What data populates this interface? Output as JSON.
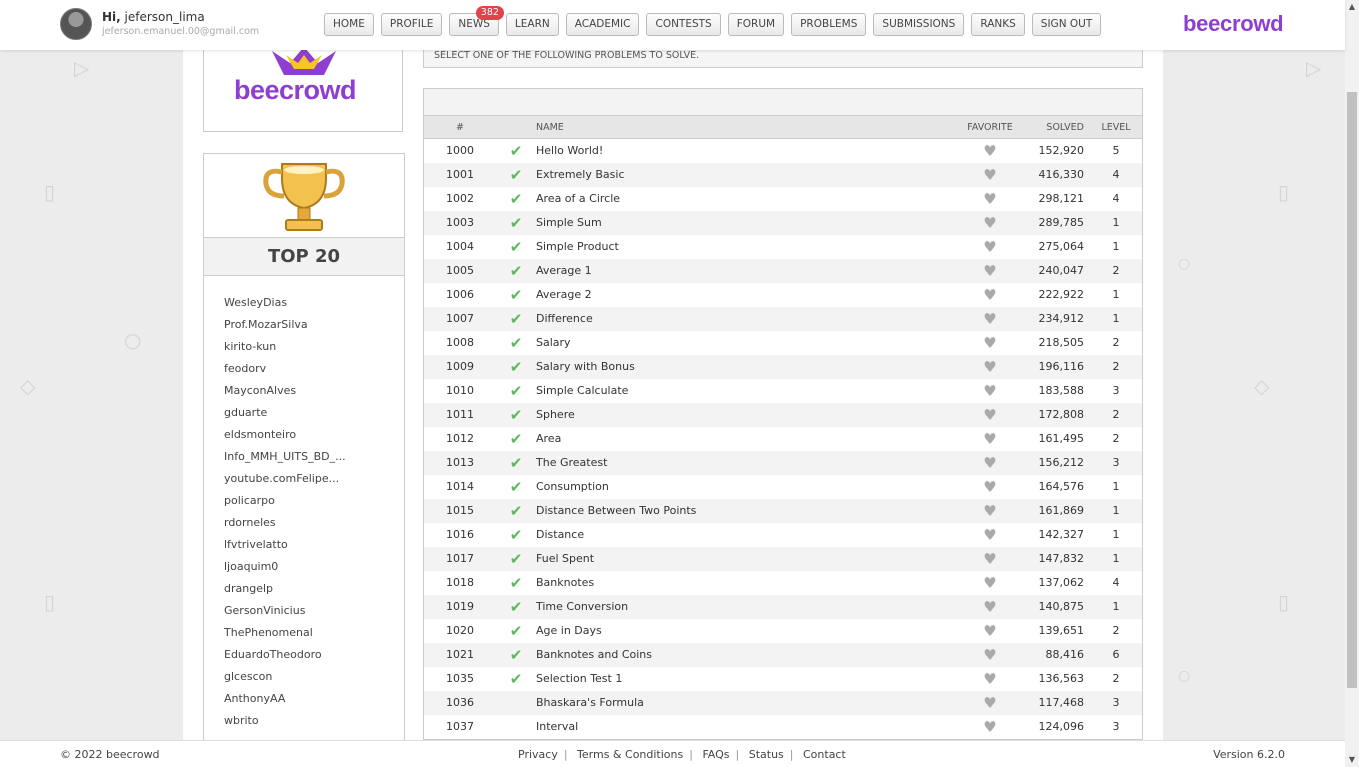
{
  "user": {
    "greeting_prefix": "Hi,",
    "username": "jeferson_lima",
    "email": "jeferson.emanuel.00@gmail.com"
  },
  "nav": [
    {
      "label": "HOME",
      "name": "nav-home"
    },
    {
      "label": "PROFILE",
      "name": "nav-profile"
    },
    {
      "label": "NEWS",
      "name": "nav-news",
      "badge": "382"
    },
    {
      "label": "LEARN",
      "name": "nav-learn"
    },
    {
      "label": "ACADEMIC",
      "name": "nav-academic"
    },
    {
      "label": "CONTESTS",
      "name": "nav-contests"
    },
    {
      "label": "FORUM",
      "name": "nav-forum"
    },
    {
      "label": "PROBLEMS",
      "name": "nav-problems"
    },
    {
      "label": "SUBMISSIONS",
      "name": "nav-submissions"
    },
    {
      "label": "RANKS",
      "name": "nav-ranks"
    },
    {
      "label": "SIGN OUT",
      "name": "nav-sign-out"
    }
  ],
  "brand": "beecrowd",
  "logo_text": "beecrowd",
  "instructions": "SELECT ONE OF THE FOLLOWING PROBLEMS TO SOLVE.",
  "top20": {
    "title": "TOP 20",
    "users": [
      "WesleyDias",
      "Prof.MozarSilva",
      "kirito-kun",
      "feodorv",
      "MayconAlves",
      "gduarte",
      "eldsmonteiro",
      "Info_MMH_UITS_BD_...",
      "youtube.comFelipe...",
      "policarpo",
      "rdorneles",
      "lfvtrivelatto",
      "ljoaquim0",
      "drangelp",
      "GersonVinicius",
      "ThePhenomenal",
      "EduardoTheodoro",
      "glcescon",
      "AnthonyAA",
      "wbrito"
    ]
  },
  "table": {
    "headers": {
      "id": "#",
      "name": "NAME",
      "favorite": "FAVORITE",
      "solved": "SOLVED",
      "level": "LEVEL"
    },
    "rows": [
      {
        "id": "1000",
        "solved_by_me": true,
        "name": "Hello World!",
        "solved": "152,920",
        "level": "5"
      },
      {
        "id": "1001",
        "solved_by_me": true,
        "name": "Extremely Basic",
        "solved": "416,330",
        "level": "4"
      },
      {
        "id": "1002",
        "solved_by_me": true,
        "name": "Area of a Circle",
        "solved": "298,121",
        "level": "4"
      },
      {
        "id": "1003",
        "solved_by_me": true,
        "name": "Simple Sum",
        "solved": "289,785",
        "level": "1"
      },
      {
        "id": "1004",
        "solved_by_me": true,
        "name": "Simple Product",
        "solved": "275,064",
        "level": "1"
      },
      {
        "id": "1005",
        "solved_by_me": true,
        "name": "Average 1",
        "solved": "240,047",
        "level": "2"
      },
      {
        "id": "1006",
        "solved_by_me": true,
        "name": "Average 2",
        "solved": "222,922",
        "level": "1"
      },
      {
        "id": "1007",
        "solved_by_me": true,
        "name": "Difference",
        "solved": "234,912",
        "level": "1"
      },
      {
        "id": "1008",
        "solved_by_me": true,
        "name": "Salary",
        "solved": "218,505",
        "level": "2"
      },
      {
        "id": "1009",
        "solved_by_me": true,
        "name": "Salary with Bonus",
        "solved": "196,116",
        "level": "2"
      },
      {
        "id": "1010",
        "solved_by_me": true,
        "name": "Simple Calculate",
        "solved": "183,588",
        "level": "3"
      },
      {
        "id": "1011",
        "solved_by_me": true,
        "name": "Sphere",
        "solved": "172,808",
        "level": "2"
      },
      {
        "id": "1012",
        "solved_by_me": true,
        "name": "Area",
        "solved": "161,495",
        "level": "2"
      },
      {
        "id": "1013",
        "solved_by_me": true,
        "name": "The Greatest",
        "solved": "156,212",
        "level": "3"
      },
      {
        "id": "1014",
        "solved_by_me": true,
        "name": "Consumption",
        "solved": "164,576",
        "level": "1"
      },
      {
        "id": "1015",
        "solved_by_me": true,
        "name": "Distance Between Two Points",
        "solved": "161,869",
        "level": "1"
      },
      {
        "id": "1016",
        "solved_by_me": true,
        "name": "Distance",
        "solved": "142,327",
        "level": "1"
      },
      {
        "id": "1017",
        "solved_by_me": true,
        "name": "Fuel Spent",
        "solved": "147,832",
        "level": "1"
      },
      {
        "id": "1018",
        "solved_by_me": true,
        "name": "Banknotes",
        "solved": "137,062",
        "level": "4"
      },
      {
        "id": "1019",
        "solved_by_me": true,
        "name": "Time Conversion",
        "solved": "140,875",
        "level": "1"
      },
      {
        "id": "1020",
        "solved_by_me": true,
        "name": "Age in Days",
        "solved": "139,651",
        "level": "2"
      },
      {
        "id": "1021",
        "solved_by_me": true,
        "name": "Banknotes and Coins",
        "solved": "88,416",
        "level": "6"
      },
      {
        "id": "1035",
        "solved_by_me": true,
        "name": "Selection Test 1",
        "solved": "136,563",
        "level": "2"
      },
      {
        "id": "1036",
        "solved_by_me": false,
        "name": "Bhaskara's Formula",
        "solved": "117,468",
        "level": "3"
      },
      {
        "id": "1037",
        "solved_by_me": false,
        "name": "Interval",
        "solved": "124,096",
        "level": "3"
      }
    ]
  },
  "footer": {
    "copyright": "© 2022 beecrowd",
    "links": [
      "Privacy",
      "Terms & Conditions",
      "FAQs",
      "Status",
      "Contact"
    ],
    "version": "Version 6.2.0"
  },
  "icons": {
    "solved": "check-icon",
    "favorite": "heart-icon"
  },
  "colors": {
    "brand": "#8e3fcf",
    "check": "#5cb85c",
    "badge": "#e0434a"
  }
}
